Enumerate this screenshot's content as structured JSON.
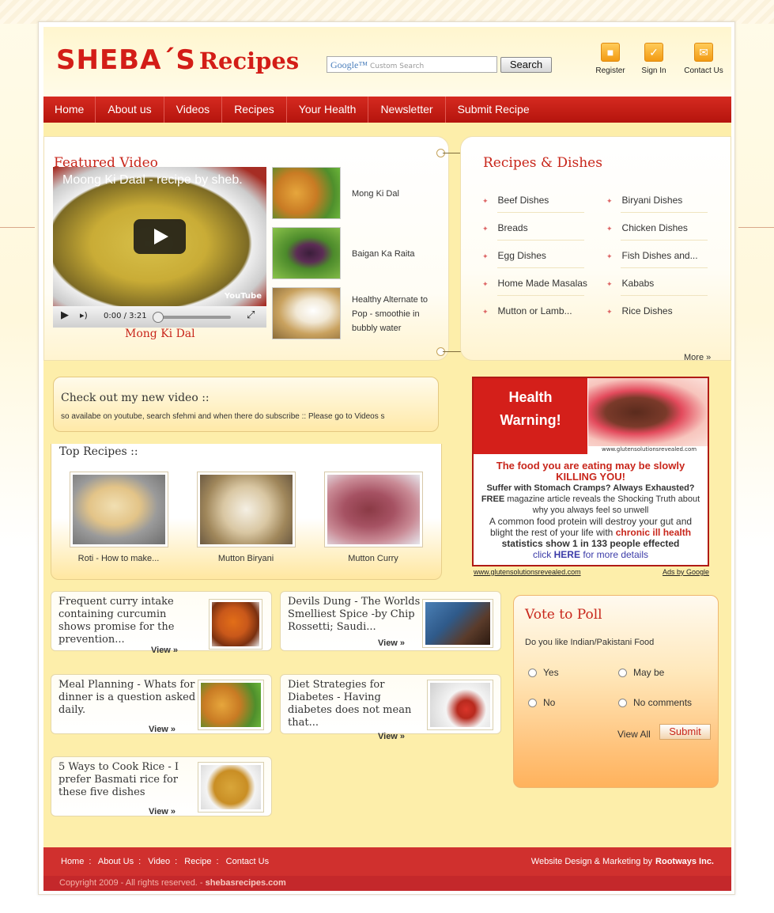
{
  "header": {
    "logo_part1": "SHEBA´S",
    "logo_part2": "Recipes",
    "search_brand": "Google™",
    "search_placeholder": "Custom Search",
    "search_button": "Search",
    "links": [
      {
        "label": "Register",
        "icon": "lock-icon"
      },
      {
        "label": "Sign In",
        "icon": "checkmark-icon"
      },
      {
        "label": "Contact Us",
        "icon": "envelope-icon"
      }
    ]
  },
  "nav": [
    "Home",
    "About us",
    "Videos",
    "Recipes",
    "Your Health",
    "Newsletter",
    "Submit Recipe"
  ],
  "featured": {
    "title": "Featured Video",
    "video_title": "Moong Ki Daal - recipe by sheb.",
    "video_time": "0:00 / 3:21",
    "video_brand": "YouTube",
    "caption": "Mong Ki Dal",
    "items": [
      "Mong Ki Dal",
      "Baigan Ka Raita",
      "Healthy Alternate to Pop - smoothie in bubbly water"
    ]
  },
  "recipes_dishes": {
    "title": "Recipes & Dishes",
    "left": [
      "Beef Dishes",
      "Breads",
      "Egg Dishes",
      "Home Made Masalas",
      "Mutton or Lamb..."
    ],
    "right": [
      "Biryani Dishes",
      "Chicken Dishes",
      "Fish Dishes and...",
      "Kababs",
      "Rice Dishes"
    ],
    "more": "More »"
  },
  "new_video": {
    "title": "Check out my new video ::",
    "marquee": "so availabe on youtube, search sfehmi and when there do subscribe  ::  Please go to Videos s"
  },
  "top_recipes": {
    "title": "Top Recipes ::",
    "items": [
      "Roti - How to make...",
      "Mutton Biryani",
      "Mutton Curry"
    ]
  },
  "ad": {
    "headline1": "Health",
    "headline2": "Warning!",
    "img_url": "www.glutensolutionsrevealed.com",
    "line1": "The food you are eating may be slowly",
    "line2": "KILLING YOU!",
    "line3": "Suffer with Stomach Cramps? Always Exhausted?",
    "line4a": "FREE",
    "line4b": " magazine article reveals the Shocking Truth about",
    "line5": "why you always feel so unwell",
    "line6": "A common food protein will destroy your gut and",
    "line7a": "blight the rest of your life with ",
    "line7b": "chronic ill health",
    "line8": "statistics show 1 in 133 people effected",
    "line9a": "click ",
    "line9b": "HERE",
    "line9c": " for more details",
    "foot_url": "www.glutensolutionsrevealed.com",
    "foot_ads": "Ads by Google"
  },
  "articles": [
    {
      "title": "Frequent curry intake containing curcumin shows promise for the prevention...",
      "view": "View »"
    },
    {
      "title": "Devils Dung - The Worlds Smelliest Spice -by Chip Rossetti; Saudi...",
      "view": "View »"
    },
    {
      "title": "Meal Planning - Whats for dinner is a question asked daily.",
      "view": "View »"
    },
    {
      "title": "Diet Strategies for Diabetes - Having diabetes does not mean that...",
      "view": "View »"
    },
    {
      "title": "5 Ways to Cook Rice - I prefer Basmati rice for these five dishes",
      "view": "View »"
    }
  ],
  "poll": {
    "title": "Vote to Poll",
    "question": "Do you like Indian/Pakistani Food",
    "options": [
      "Yes",
      "May be",
      "No",
      "No comments"
    ],
    "view_all": "View All",
    "submit": "Submit"
  },
  "footer": {
    "links": [
      "Home",
      "About Us",
      "Video",
      "Recipe",
      "Contact Us"
    ],
    "sep": ":",
    "credit_text": "Website Design & Marketing by",
    "credit_company": "Rootways Inc.",
    "copyright": "Copyright 2009 - All rights reserved. -",
    "domain": "shebasrecipes.com"
  },
  "colors": {
    "brand_red": "#d31d17",
    "nav_red": "#c8201a",
    "panel_yellow": "#fdeeaa"
  }
}
